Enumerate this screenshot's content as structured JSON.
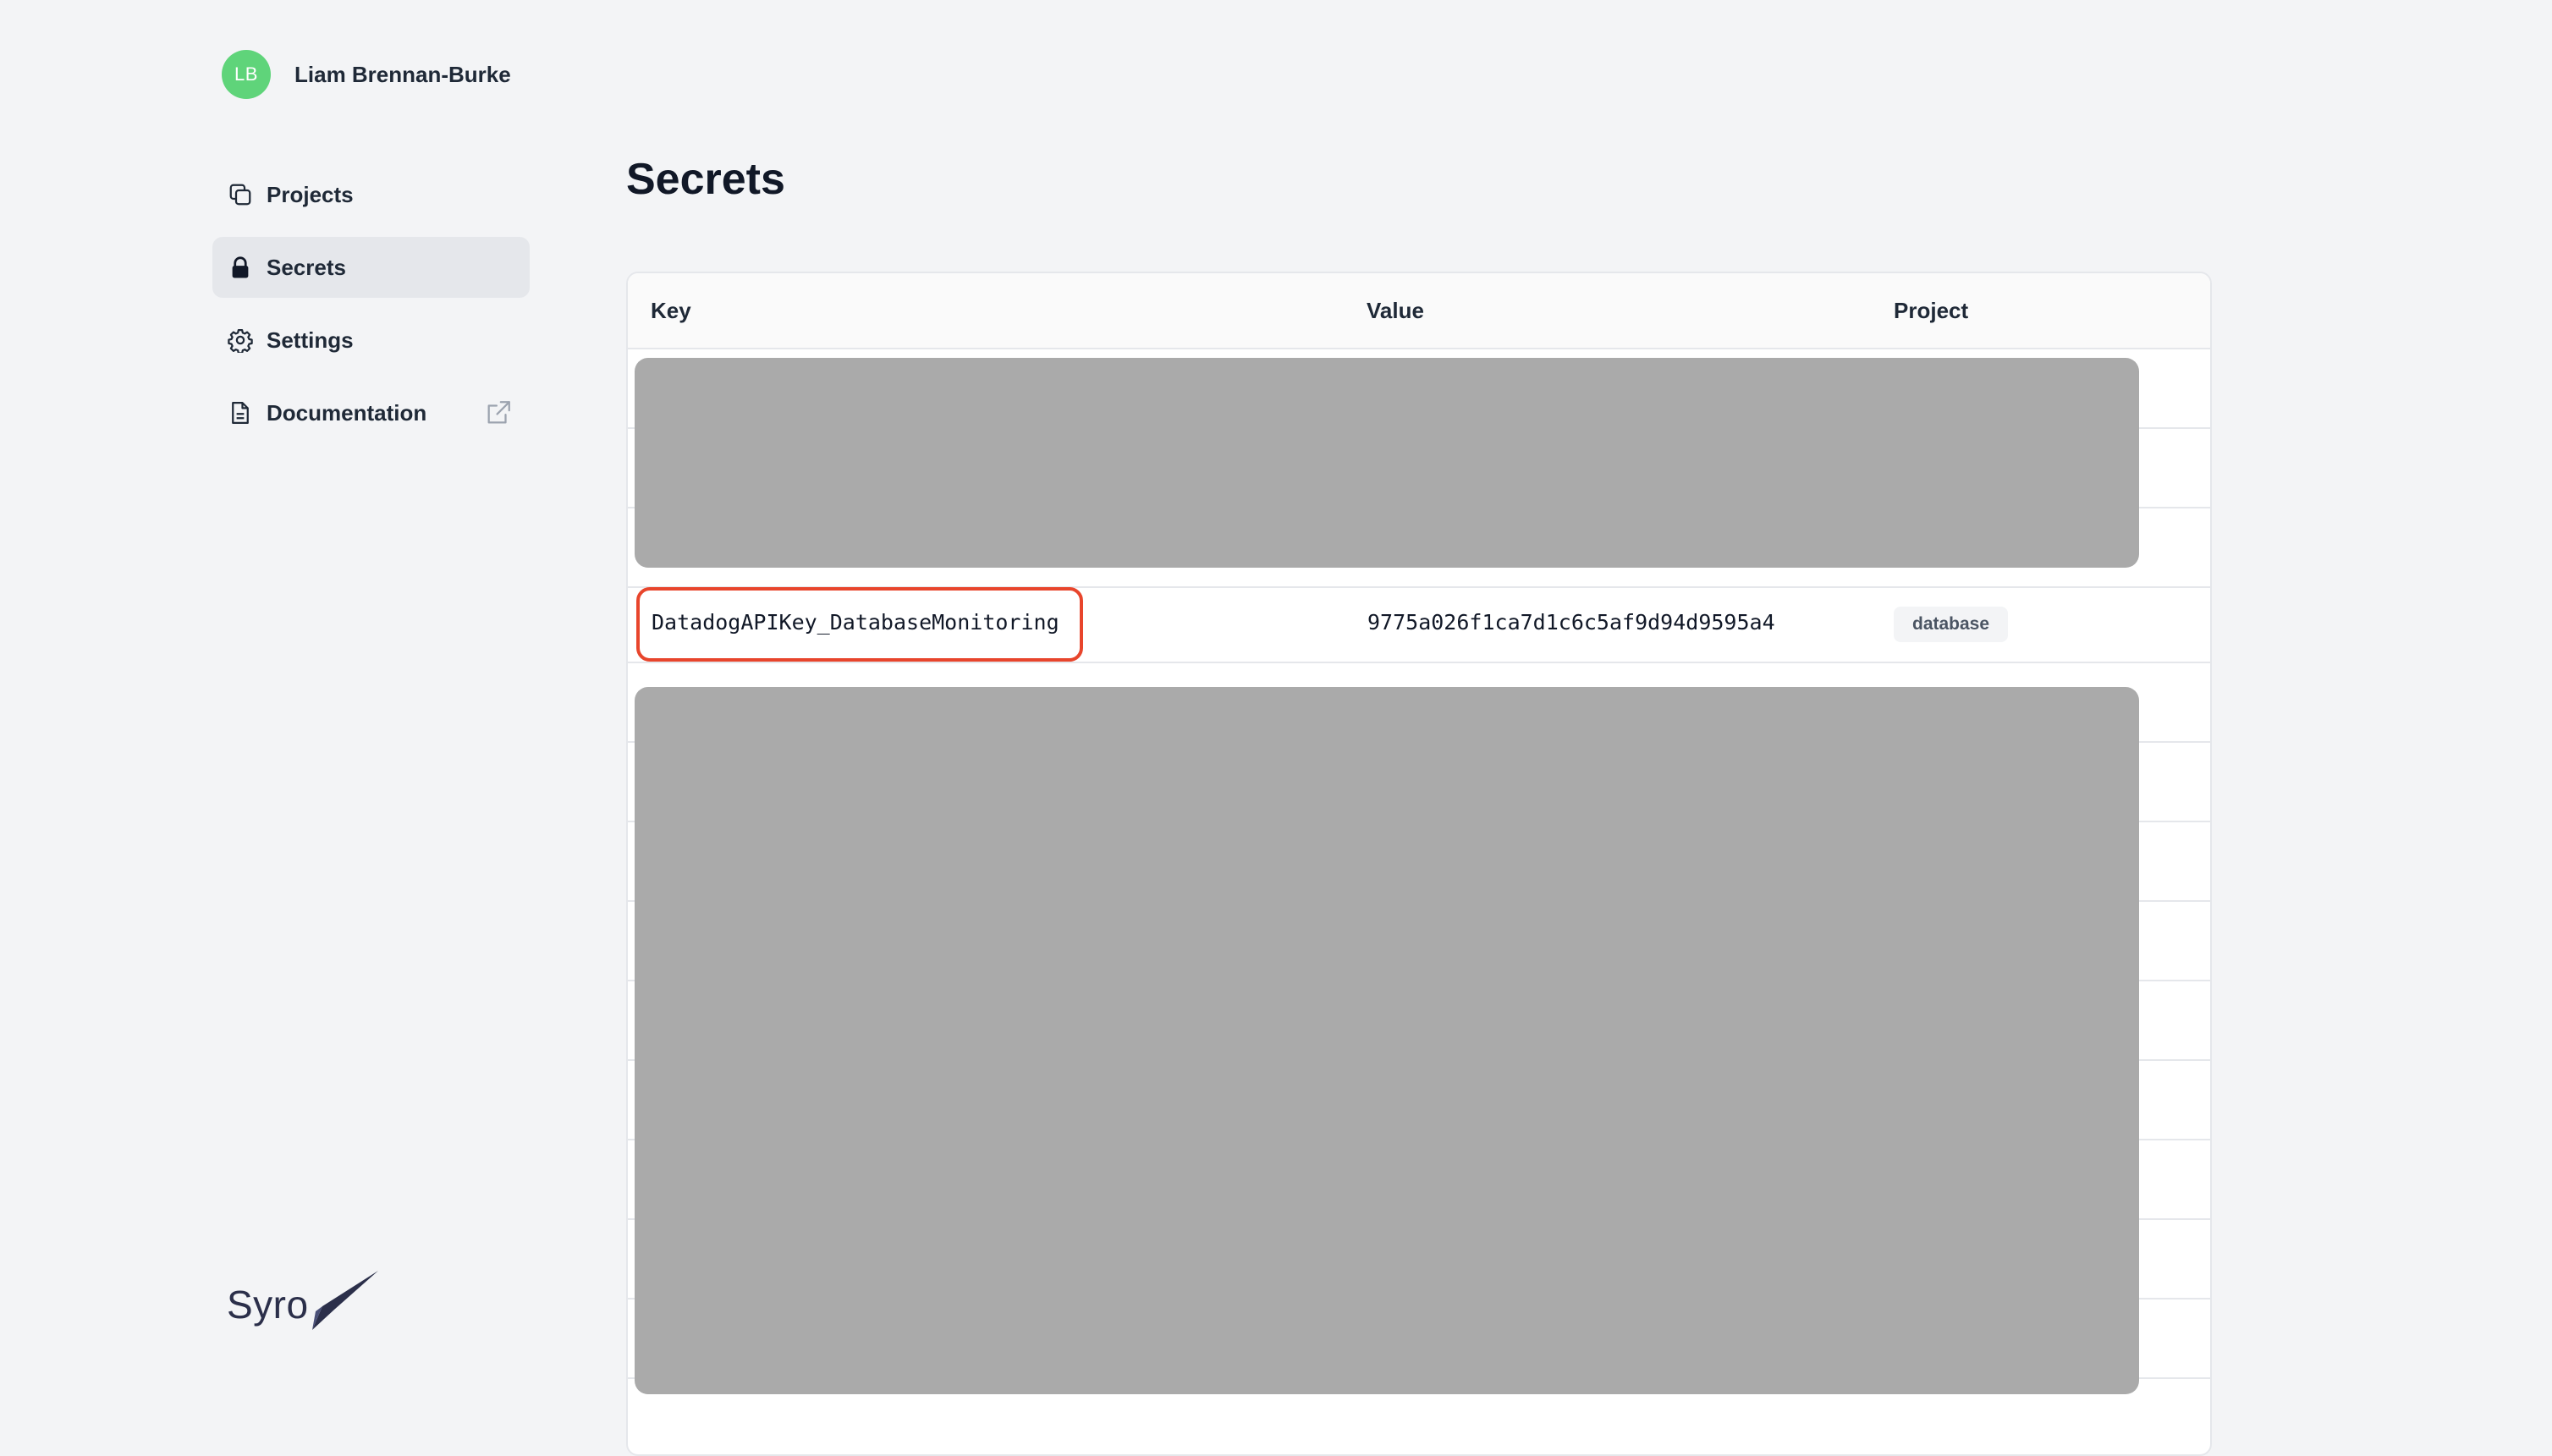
{
  "user": {
    "initials": "LB",
    "name": "Liam Brennan-Burke"
  },
  "nav": {
    "items": [
      {
        "label": "Projects",
        "icon": "projects-icon",
        "active": false
      },
      {
        "label": "Secrets",
        "icon": "lock-icon",
        "active": true
      },
      {
        "label": "Settings",
        "icon": "gear-icon",
        "active": false
      },
      {
        "label": "Documentation",
        "icon": "document-icon",
        "active": false,
        "external": true
      }
    ]
  },
  "logo": {
    "text": "Syro"
  },
  "page": {
    "title": "Secrets"
  },
  "table": {
    "columns": [
      "Key",
      "Value",
      "Project"
    ],
    "visible_row": {
      "key": "DatadogAPIKey_DatabaseMonitoring",
      "value": "9775a026f1ca7d1c6c5af9d94d9595a4",
      "project": "database"
    }
  },
  "colors": {
    "background": "#f3f4f6",
    "avatar": "#5fd47a",
    "highlight_border": "#e8452c",
    "redaction": "#aaaaaa",
    "logo": "#2b2f4a"
  }
}
